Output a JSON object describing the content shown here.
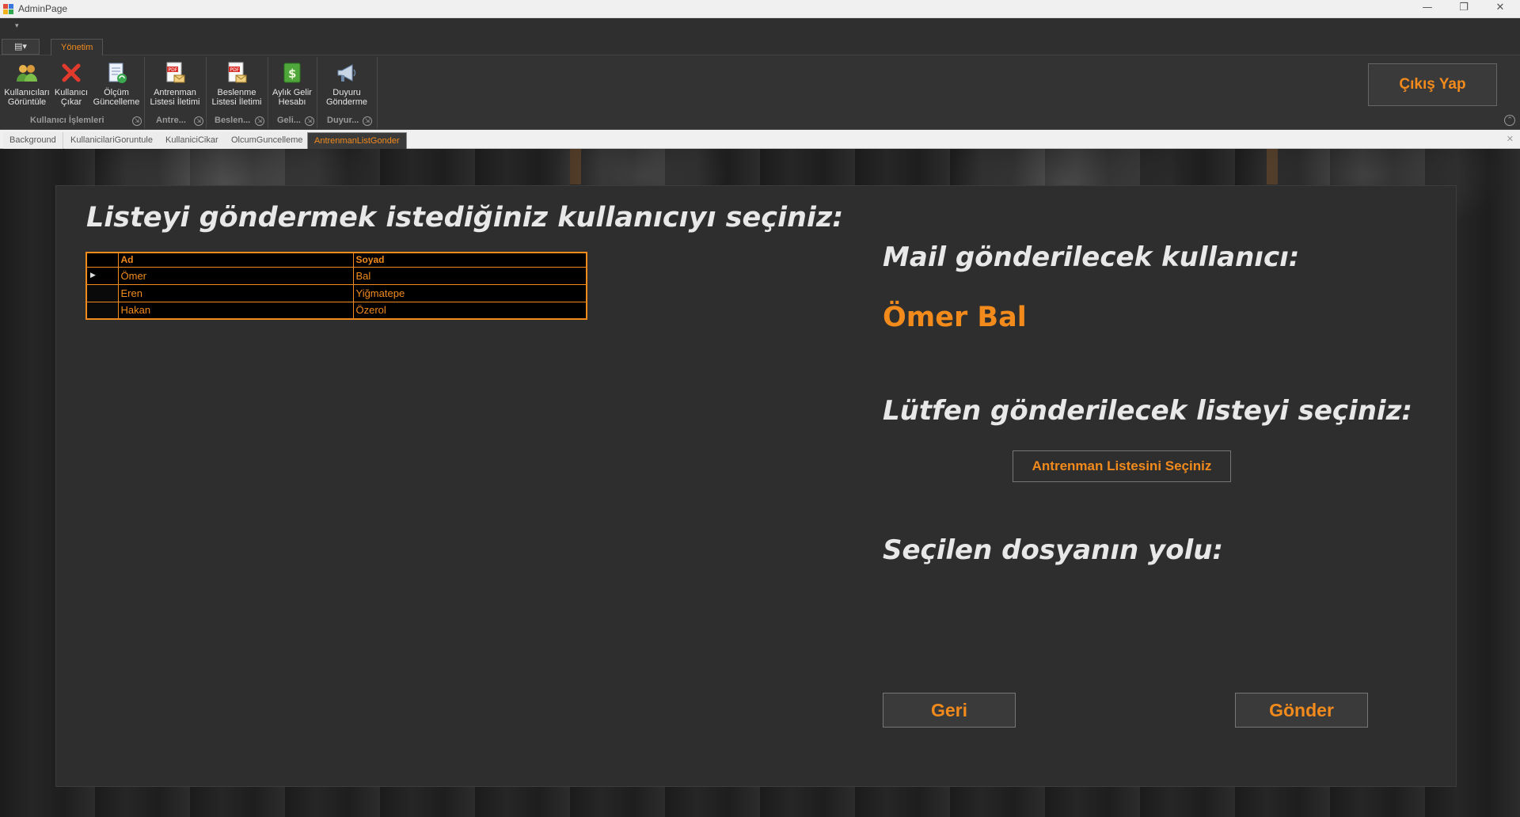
{
  "window": {
    "title": "AdminPage",
    "controls": [
      "—",
      "❐",
      "✕"
    ]
  },
  "ribbon": {
    "app_menu_glyph": "▤▾",
    "active_tab": "Yönetim",
    "buttons": [
      {
        "id": "kullanicilari-goruntule",
        "label": "Kullanıcıları\nGörüntüle",
        "icon": "users-icon"
      },
      {
        "id": "kullanici-cikar",
        "label": "Kullanıcı\nÇıkar",
        "icon": "red-x-icon"
      },
      {
        "id": "olcum-guncelleme",
        "label": "Ölçüm\nGüncelleme",
        "icon": "document-refresh-icon"
      },
      {
        "id": "antrenman-listesi-iletimi",
        "label": "Antrenman\nListesi İletimi",
        "icon": "pdf-mail-icon"
      },
      {
        "id": "beslenme-listesi-iletimi",
        "label": "Beslenme\nListesi İletimi",
        "icon": "pdf-mail-icon"
      },
      {
        "id": "aylik-gelir-hesabi",
        "label": "Aylık Gelir\nHesabı",
        "icon": "money-icon"
      },
      {
        "id": "duyuru-gonderme",
        "label": "Duyuru\nGönderme",
        "icon": "megaphone-icon"
      }
    ],
    "groups": [
      "Kullanıcı İşlemleri",
      "Antre...",
      "Beslen...",
      "Geli...",
      "Duyur..."
    ],
    "exit_label": "Çıkış Yap"
  },
  "doc_tabs": [
    "Background",
    "KullanicilariGoruntule",
    "KullaniciCikar",
    "OlcumGuncelleme",
    "AntrenmanListGonder"
  ],
  "doc_tabs_active": "AntrenmanListGonder",
  "panel": {
    "left_heading": "Listeyi göndermek istediğiniz kullanıcıyı seçiniz:",
    "grid": {
      "columns": [
        "Ad",
        "Soyad"
      ],
      "rows": [
        {
          "ad": "Ömer",
          "soyad": "Bal"
        },
        {
          "ad": "Eren",
          "soyad": "Yiğmatepe"
        },
        {
          "ad": "Hakan",
          "soyad": "Özerol"
        }
      ],
      "current_row_marker": "▶"
    },
    "mail_heading": "Mail gönderilecek kullanıcı:",
    "selected_user": "Ömer Bal",
    "list_heading": "Lütfen gönderilecek listeyi seçiniz:",
    "pick_button": "Antrenman Listesini Seçiniz",
    "path_heading": "Seçilen dosyanın yolu:",
    "back_button": "Geri",
    "send_button": "Gönder"
  },
  "colors": {
    "accent": "#f28a1c",
    "panel_bg": "#2e2e2e",
    "ribbon_bg": "#333333"
  }
}
